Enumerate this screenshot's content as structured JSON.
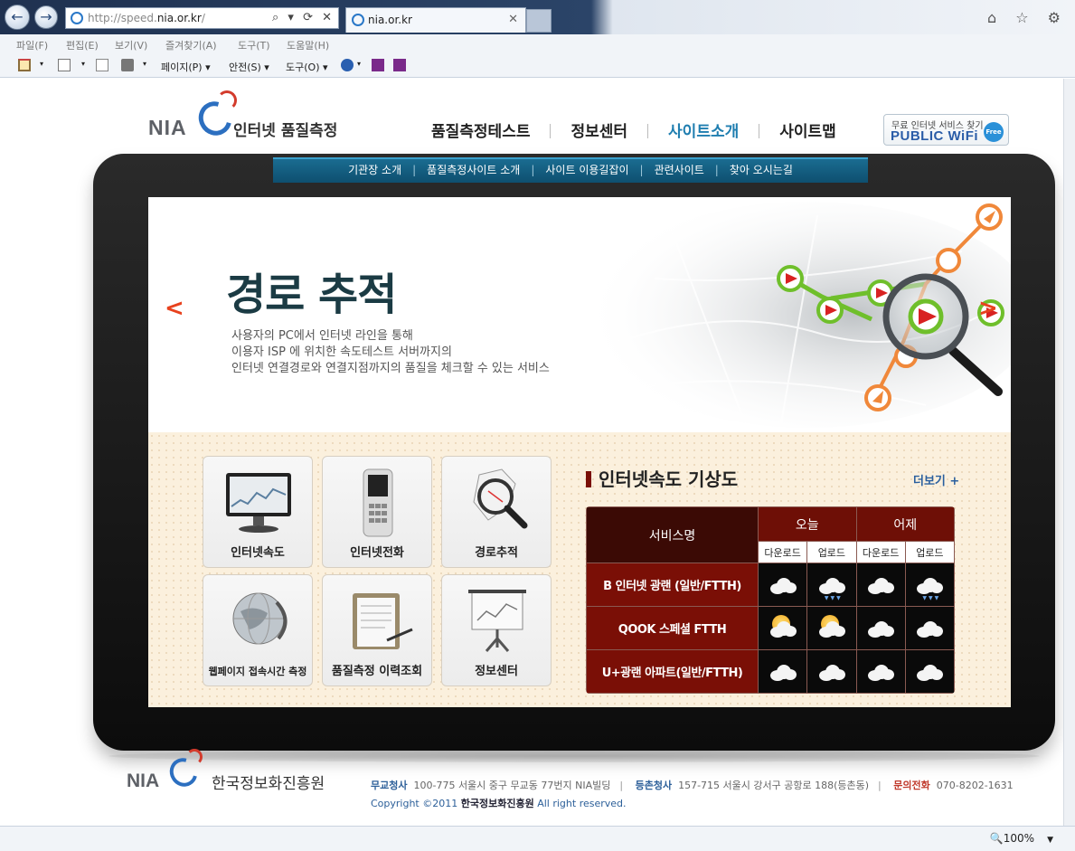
{
  "browser": {
    "url_prefix": "http://speed.",
    "url_host": "nia.or.kr",
    "url_suffix": "/",
    "address_controls": "⌕ ▾ ⟳ ✕",
    "tab_title": "nia.or.kr",
    "tab_close": "✕",
    "right_icons": "⌂ ☆ ⚙",
    "menu": [
      "파일(F)",
      "편집(E)",
      "보기(V)",
      "즐겨찾기(A)",
      "도구(T)",
      "도움말(H)"
    ],
    "commands": [
      "페이지(P) ▾",
      "안전(S) ▾",
      "도구(O) ▾"
    ],
    "zoom": "100%"
  },
  "site": {
    "logo_text": "NIA",
    "site_name": "인터넷 품질측정",
    "gnb": [
      "품질측정테스트",
      "정보센터",
      "사이트소개",
      "사이트맵"
    ],
    "gnb_active_index": 2,
    "wifi_line1": "무료 인터넷 서비스 찾기",
    "wifi_line2": "PUBLIC WiFi",
    "wifi_badge": "Free",
    "subnav": [
      "기관장 소개",
      "품질측정사이트 소개",
      "사이트 이용길잡이",
      "관련사이트",
      "찾아 오시는길"
    ]
  },
  "hero": {
    "title": "경로 추적",
    "desc_lines": [
      "사용자의 PC에서 인터넷 라인을 통해",
      "이용자 ISP 에 위치한 속도테스트 서버까지의",
      "인터넷 연결경로와 연결지점까지의 품질을 체크할 수 있는 서비스"
    ],
    "prev": "<",
    "next": ">"
  },
  "quick_links": [
    {
      "label": "인터넷속도",
      "icon": "monitor-icon"
    },
    {
      "label": "인터넷전화",
      "icon": "phone-icon"
    },
    {
      "label": "경로추적",
      "icon": "magnifier-map-icon"
    },
    {
      "label": "웹페이지 접속시간 측정",
      "icon": "globe-icon"
    },
    {
      "label": "품질측정 이력조회",
      "icon": "clipboard-icon"
    },
    {
      "label": "정보센터",
      "icon": "presentation-board-icon"
    }
  ],
  "weather": {
    "title": "인터넷속도 기상도",
    "more": "더보기 +",
    "header_service": "서비스명",
    "header_today": "오늘",
    "header_yesterday": "어제",
    "sub_download": "다운로드",
    "sub_upload": "업로드",
    "rows": [
      {
        "service": "B 인터넷 광랜 (일반/FTTH)",
        "cells": [
          "cloudy",
          "rain",
          "cloudy",
          "rain"
        ]
      },
      {
        "service": "QOOK 스페셜 FTTH",
        "cells": [
          "sunny-cloudy",
          "sunny-cloudy",
          "cloudy",
          "cloudy"
        ]
      },
      {
        "service": "U+광랜 아파트(일반/FTTH)",
        "cells": [
          "cloudy",
          "cloudy",
          "cloudy",
          "cloudy"
        ]
      }
    ]
  },
  "footer": {
    "org_name": "한국정보화진흥원",
    "hq_label": "무교청사",
    "hq_addr": "100-775 서울시 중구 무교동 77번지 NIA빌딩",
    "branch_label": "등촌청사",
    "branch_addr": "157-715 서울시 강서구 공항로 188(등촌동)",
    "tel_label": "문의전화",
    "tel": "070-8202-1631",
    "copy_prefix": "Copyright  ©2011 ",
    "copy_org": "한국정보화진흥원",
    "copy_suffix": " All right reserved."
  },
  "colors": {
    "accent": "#1f7eb0",
    "subnav": "#0e4f6f",
    "weather_dark": "#3b0a05",
    "weather_red": "#7a0f06",
    "hero_arrow": "#e8421e"
  }
}
